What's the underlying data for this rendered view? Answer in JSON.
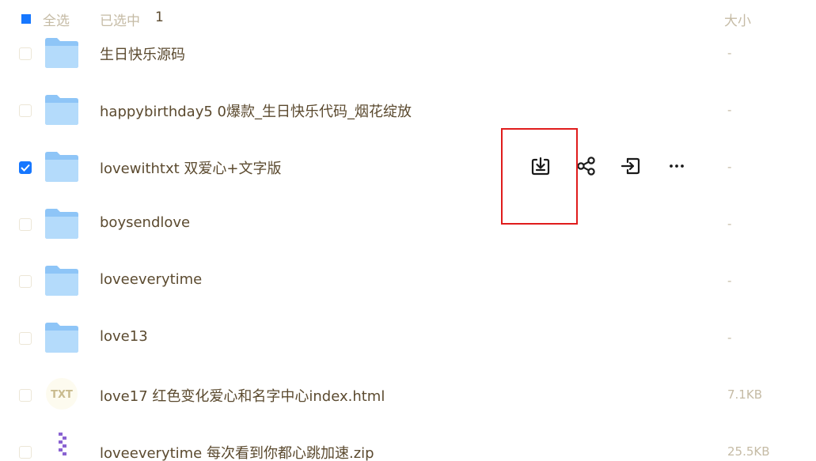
{
  "header": {
    "select_all_label": "全选",
    "selected_label": "已选中",
    "selected_count": "1",
    "size_column_label": "大小"
  },
  "files": [
    {
      "name": "生日快乐源码",
      "size": "-",
      "type": "folder",
      "checked": false
    },
    {
      "name": "happybirthday5 0爆款_生日快乐代码_烟花绽放",
      "size": "-",
      "type": "folder",
      "checked": false
    },
    {
      "name": "lovewithtxt 双爱心+文字版",
      "size": "-",
      "type": "folder",
      "checked": true
    },
    {
      "name": "boysendlove",
      "size": "-",
      "type": "folder",
      "checked": false
    },
    {
      "name": "loveeverytime",
      "size": "-",
      "type": "folder",
      "checked": false
    },
    {
      "name": "love13",
      "size": "-",
      "type": "folder",
      "checked": false
    },
    {
      "name": "love17 红色变化爱心和名字中心index.html",
      "size": "7.1KB",
      "type": "txt",
      "checked": false
    },
    {
      "name": "loveeverytime 每次看到你都心跳加速.zip",
      "size": "25.5KB",
      "type": "zip",
      "checked": false
    }
  ],
  "txt_icon_label": "TXT",
  "row_actions": [
    {
      "icon": "download-icon"
    },
    {
      "icon": "share-icon"
    },
    {
      "icon": "move-to-icon"
    },
    {
      "icon": "more-icon"
    }
  ],
  "colors": {
    "accent": "#1677ff",
    "folder": "#8ec5f7",
    "highlight": "#e01c1c"
  }
}
